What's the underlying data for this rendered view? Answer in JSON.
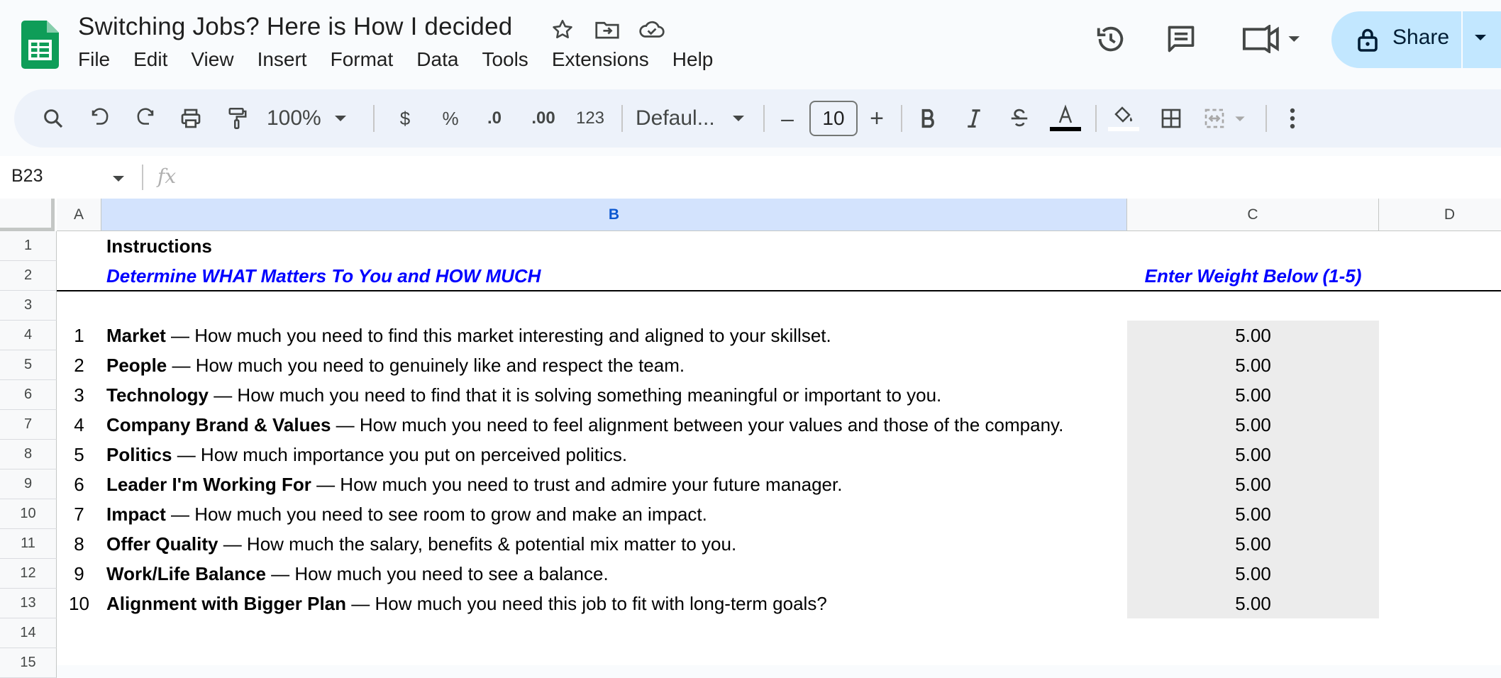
{
  "app": {
    "doc_title": "Switching Jobs?  Here is How I decided",
    "menu": [
      "File",
      "Edit",
      "View",
      "Insert",
      "Format",
      "Data",
      "Tools",
      "Extensions",
      "Help"
    ],
    "share_label": "Share",
    "brand_color": "#0f9d58"
  },
  "toolbar": {
    "zoom": "100%",
    "currency": "$",
    "percent": "%",
    "decrease_decimals": ".0",
    "increase_decimals": ".00",
    "number_format": "123",
    "font_name": "Defaul...",
    "font_size": "10",
    "minus": "–",
    "plus": "+"
  },
  "formula_bar": {
    "cell_ref": "B23",
    "fx": "fx",
    "content": ""
  },
  "sheet": {
    "columns": [
      "A",
      "B",
      "C",
      "D"
    ],
    "selected_column": "B",
    "rows": [
      "1",
      "2",
      "3",
      "4",
      "5",
      "6",
      "7",
      "8",
      "9",
      "10",
      "11",
      "12",
      "13",
      "14",
      "15"
    ],
    "instructions": "Instructions",
    "subtitle": "Determine WHAT Matters To You and HOW MUCH",
    "weight_header": "Enter Weight Below (1-5)",
    "items": [
      {
        "n": "1",
        "name": "Market",
        "desc": " — How much you need to find this market interesting and aligned to your skillset.",
        "weight": "5.00"
      },
      {
        "n": "2",
        "name": "People",
        "desc": " — How much you need to genuinely like and respect the team.",
        "weight": "5.00"
      },
      {
        "n": "3",
        "name": "Technology",
        "desc": " — How much you need to find that it is solving something meaningful or important to you.",
        "weight": "5.00"
      },
      {
        "n": "4",
        "name": "Company Brand & Values",
        "desc": " — How much you need to feel alignment between your values and those of the company.",
        "weight": "5.00"
      },
      {
        "n": "5",
        "name": "Politics",
        "desc": " — How much importance you put on perceived politics.",
        "weight": "5.00"
      },
      {
        "n": "6",
        "name": "Leader I'm Working For",
        "desc": " — How much you need to trust and admire your future manager.",
        "weight": "5.00"
      },
      {
        "n": "7",
        "name": "Impact",
        "desc": " — How much you need to see room to grow and make an impact.",
        "weight": "5.00"
      },
      {
        "n": "8",
        "name": "Offer Quality",
        "desc": " — How much the salary, benefits & potential mix matter to you.",
        "weight": "5.00"
      },
      {
        "n": "9",
        "name": "Work/Life Balance",
        "desc": " — How much you need to see a balance.",
        "weight": "5.00"
      },
      {
        "n": "10",
        "name": "Alignment with Bigger Plan",
        "desc": " — How much you need this job to fit with long-term goals?",
        "weight": "5.00"
      }
    ]
  }
}
